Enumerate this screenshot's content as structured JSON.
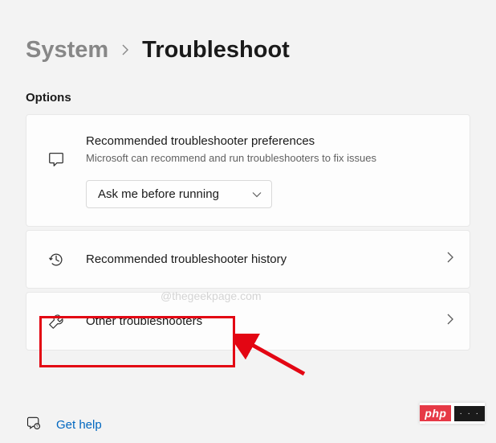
{
  "breadcrumb": {
    "parent": "System",
    "current": "Troubleshoot"
  },
  "section_label": "Options",
  "pref_card": {
    "title": "Recommended troubleshooter preferences",
    "subtitle": "Microsoft can recommend and run troubleshooters to fix issues",
    "dropdown_value": "Ask me before running"
  },
  "history_card": {
    "title": "Recommended troubleshooter history"
  },
  "other_card": {
    "title": "Other troubleshooters"
  },
  "help": {
    "label": "Get help"
  },
  "watermark": "@thegeekpage.com",
  "badge": {
    "left": "php",
    "right": "· · ·"
  }
}
